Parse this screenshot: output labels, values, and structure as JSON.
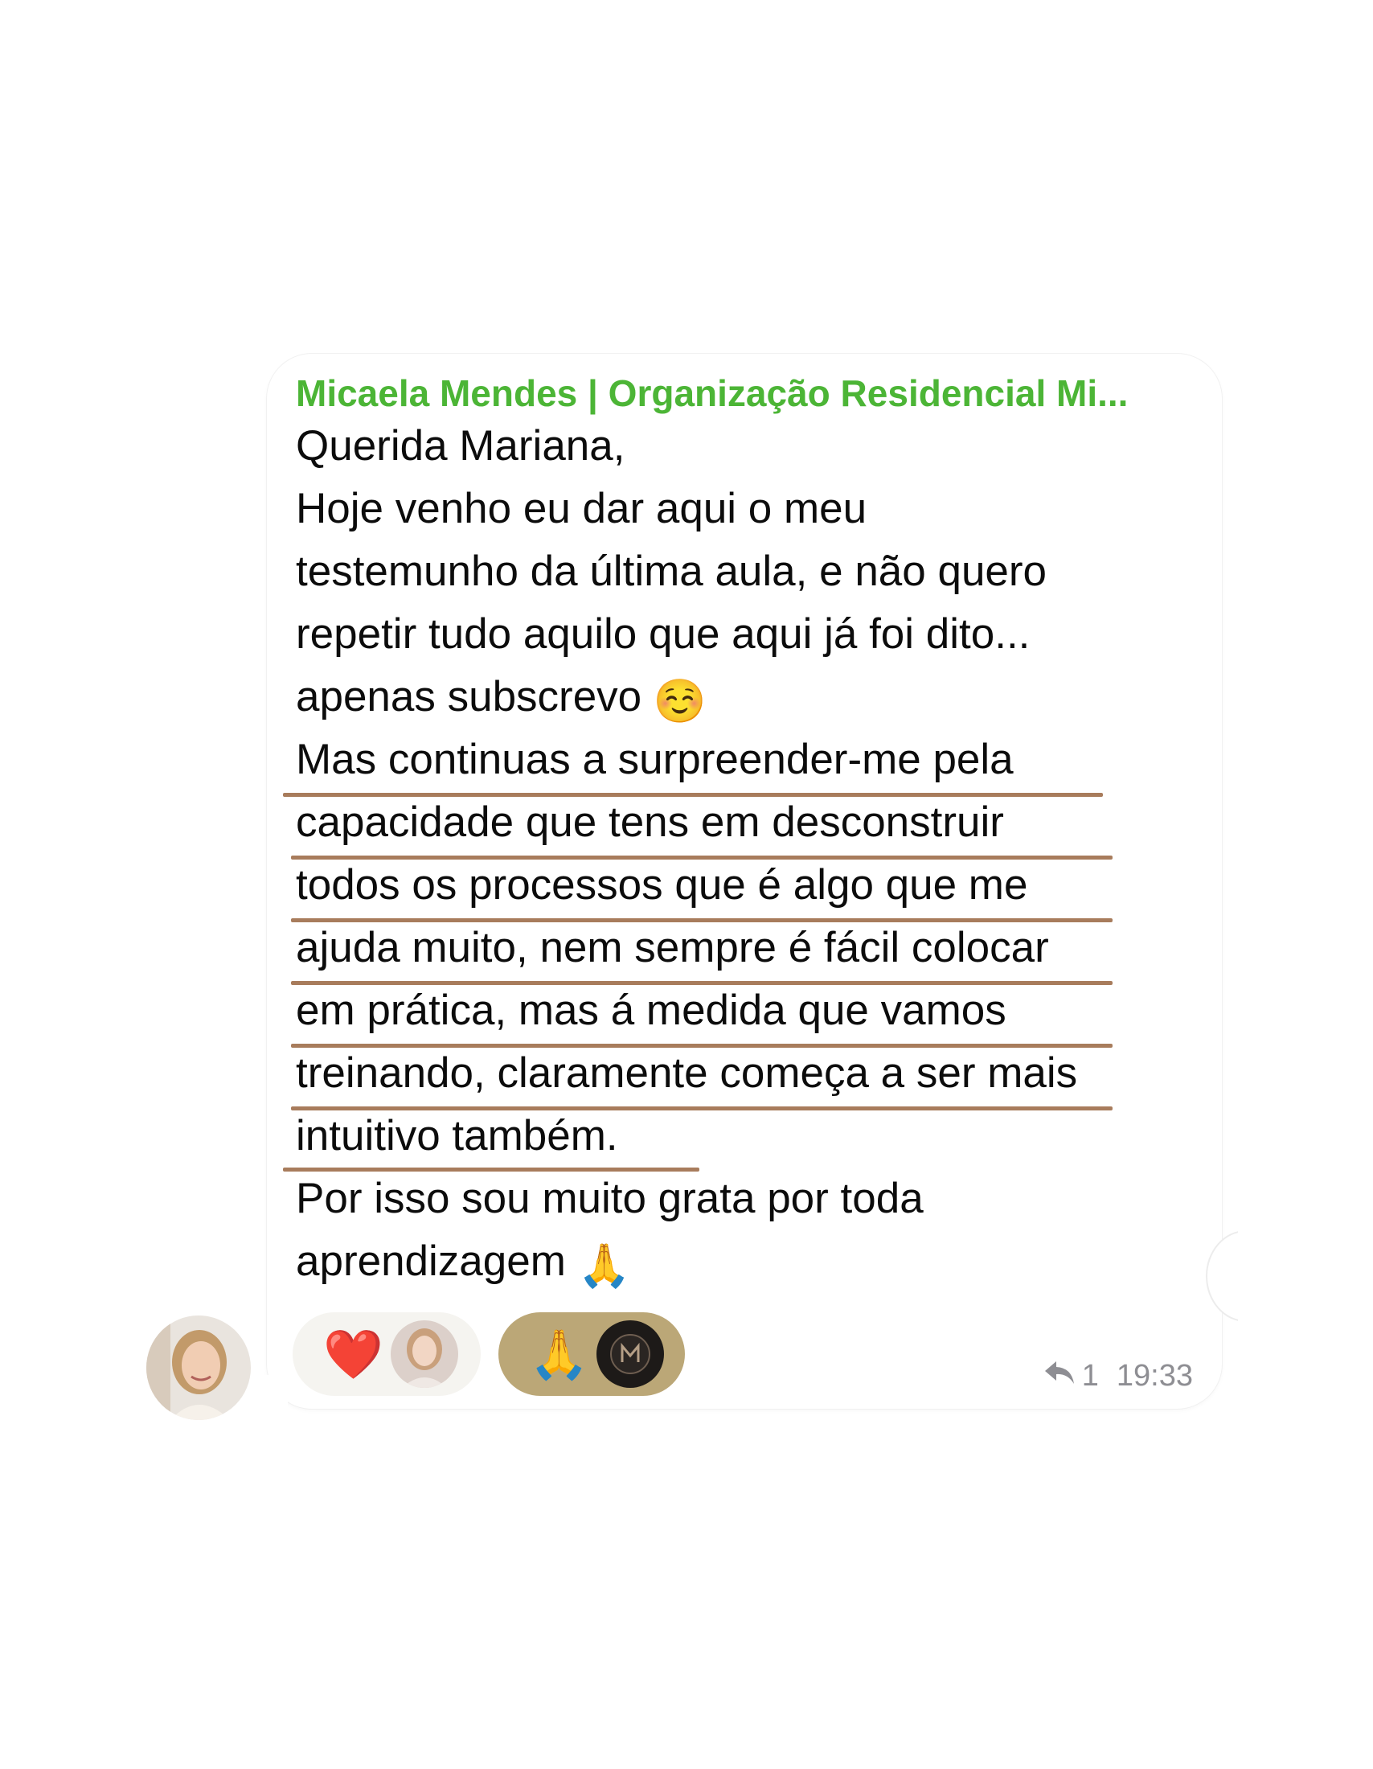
{
  "message": {
    "sender": "Micaela Mendes | Organização Residencial Mi...",
    "lines": [
      "Querida Mariana,",
      "Hoje venho eu dar aqui o meu",
      "testemunho da última aula, e não quero",
      "repetir tudo aquilo que aqui já foi dito...",
      "apenas subscrevo",
      "Mas continuas a surpreender-me pela",
      "capacidade que tens em desconstruir",
      "todos os processos  que é algo que me",
      "ajuda muito, nem sempre é fácil colocar",
      "em prática, mas á medida que vamos",
      "treinando, claramente começa a ser mais",
      "intuitivo também.",
      "Por isso sou muito grata por toda",
      "aprendizagem"
    ],
    "emoji_smile": "☺️",
    "emoji_pray": "🙏"
  },
  "reactions": [
    {
      "emoji": "❤️",
      "icon": "heart-icon"
    },
    {
      "emoji": "🙏",
      "icon": "pray-icon"
    }
  ],
  "meta": {
    "reply_count": "1",
    "time": "19:33"
  },
  "colors": {
    "sender": "#4cb536",
    "underline": "#a87c5c",
    "pray_reaction_bg": "#bba777"
  }
}
